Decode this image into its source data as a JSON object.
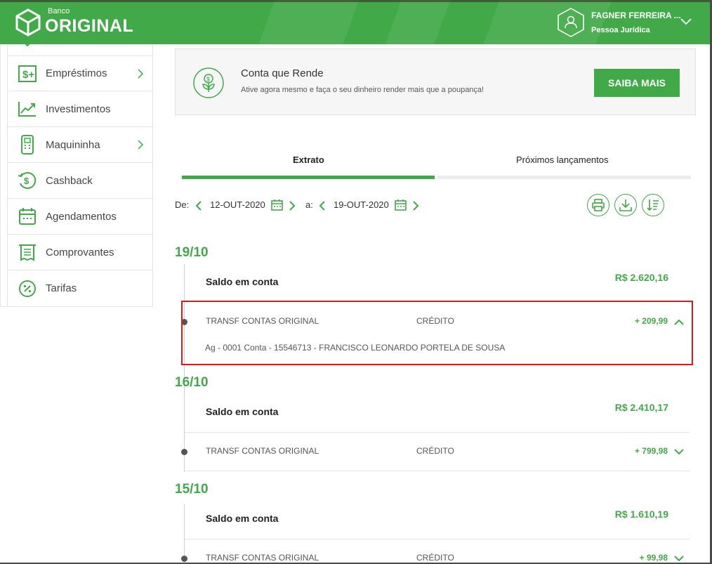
{
  "header": {
    "logo_small": "Banco",
    "logo_main": "ORIGINAL",
    "user_name": "FAGNER FERREIRA ...",
    "user_type": "Pessoa Jurídica",
    "brand_color": "#42a948"
  },
  "sidebar": {
    "items": [
      {
        "label": "Empréstimos",
        "icon": "dollar-plus-icon",
        "has_arrow": true
      },
      {
        "label": "Investimentos",
        "icon": "trend-up-icon",
        "has_arrow": false
      },
      {
        "label": "Maquininha",
        "icon": "card-machine-icon",
        "has_arrow": true
      },
      {
        "label": "Cashback",
        "icon": "cashback-icon",
        "has_arrow": false
      },
      {
        "label": "Agendamentos",
        "icon": "calendar-icon",
        "has_arrow": false
      },
      {
        "label": "Comprovantes",
        "icon": "receipt-icon",
        "has_arrow": false
      },
      {
        "label": "Tarifas",
        "icon": "percent-icon",
        "has_arrow": false
      }
    ]
  },
  "banner": {
    "title": "Conta que Rende",
    "subtitle": "Ative agora mesmo e faça o seu dinheiro render mais que a poupança!",
    "button": "SAIBA MAIS"
  },
  "tabs": {
    "active": "Extrato",
    "other": "Próximos lançamentos"
  },
  "filter": {
    "from_label": "De:",
    "from_date": "12-OUT-2020",
    "to_label": "a:",
    "to_date": "19-OUT-2020"
  },
  "statement": {
    "days": [
      {
        "date": "19/10",
        "saldo_label": "Saldo em conta",
        "saldo": "R$ 2.620,16",
        "tx": {
          "name": "TRANSF CONTAS ORIGINAL",
          "type": "CRÉDITO",
          "value": "+ 209,99",
          "detail": "Ag - 0001 Conta - 15546713 - FRANCISCO LEONARDO PORTELA DE SOUSA",
          "expanded": true
        }
      },
      {
        "date": "16/10",
        "saldo_label": "Saldo em conta",
        "saldo": "R$ 2.410,17",
        "tx": {
          "name": "TRANSF CONTAS ORIGINAL",
          "type": "CRÉDITO",
          "value": "+ 799,98",
          "expanded": false
        }
      },
      {
        "date": "15/10",
        "saldo_label": "Saldo em conta",
        "saldo": "R$ 1.610,19",
        "tx": {
          "name": "TRANSF CONTAS ORIGINAL",
          "type": "CRÉDITO",
          "value": "+ 99,98",
          "expanded": false
        }
      }
    ]
  }
}
